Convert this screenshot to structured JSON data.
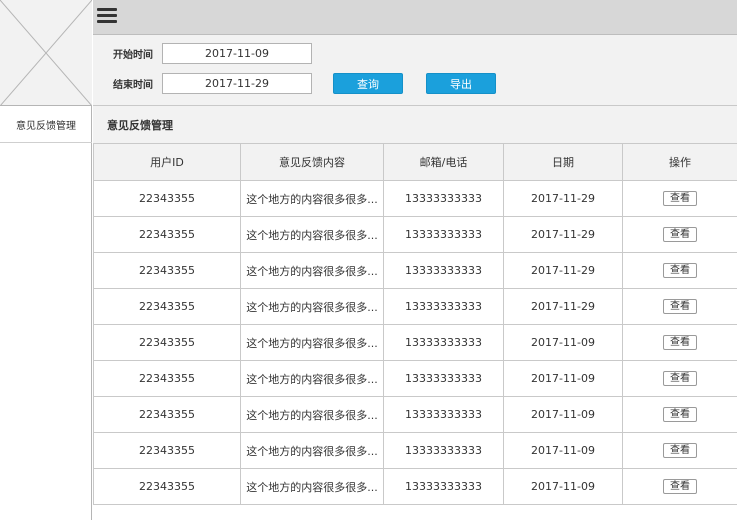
{
  "sidebar": {
    "items": [
      {
        "label": "意见反馈管理"
      }
    ]
  },
  "filter": {
    "start_label": "开始时间",
    "start_value": "2017-11-09",
    "end_label": "结束时间",
    "end_value": "2017-11-29",
    "query_button": "查询",
    "export_button": "导出"
  },
  "section": {
    "title": "意见反馈管理"
  },
  "table": {
    "columns": [
      "用户ID",
      "意见反馈内容",
      "邮箱/电话",
      "日期",
      "操作"
    ],
    "rows": [
      {
        "user_id": "22343355",
        "content": "这个地方的内容很多很多...",
        "contact": "13333333333",
        "date": "2017-11-29",
        "action": "查看"
      },
      {
        "user_id": "22343355",
        "content": "这个地方的内容很多很多...",
        "contact": "13333333333",
        "date": "2017-11-29",
        "action": "查看"
      },
      {
        "user_id": "22343355",
        "content": "这个地方的内容很多很多...",
        "contact": "13333333333",
        "date": "2017-11-29",
        "action": "查看"
      },
      {
        "user_id": "22343355",
        "content": "这个地方的内容很多很多...",
        "contact": "13333333333",
        "date": "2017-11-29",
        "action": "查看"
      },
      {
        "user_id": "22343355",
        "content": "这个地方的内容很多很多...",
        "contact": "13333333333",
        "date": "2017-11-09",
        "action": "查看"
      },
      {
        "user_id": "22343355",
        "content": "这个地方的内容很多很多...",
        "contact": "13333333333",
        "date": "2017-11-09",
        "action": "查看"
      },
      {
        "user_id": "22343355",
        "content": "这个地方的内容很多很多...",
        "contact": "13333333333",
        "date": "2017-11-09",
        "action": "查看"
      },
      {
        "user_id": "22343355",
        "content": "这个地方的内容很多很多...",
        "contact": "13333333333",
        "date": "2017-11-09",
        "action": "查看"
      },
      {
        "user_id": "22343355",
        "content": "这个地方的内容很多很多...",
        "contact": "13333333333",
        "date": "2017-11-09",
        "action": "查看"
      }
    ]
  },
  "icons": {
    "menu": "hamburger-menu-icon",
    "logo": "logo-placeholder-icon"
  },
  "colors": {
    "accent": "#1ba0dc",
    "topbar": "#d7d7d7",
    "panel": "#f2f2f2"
  }
}
